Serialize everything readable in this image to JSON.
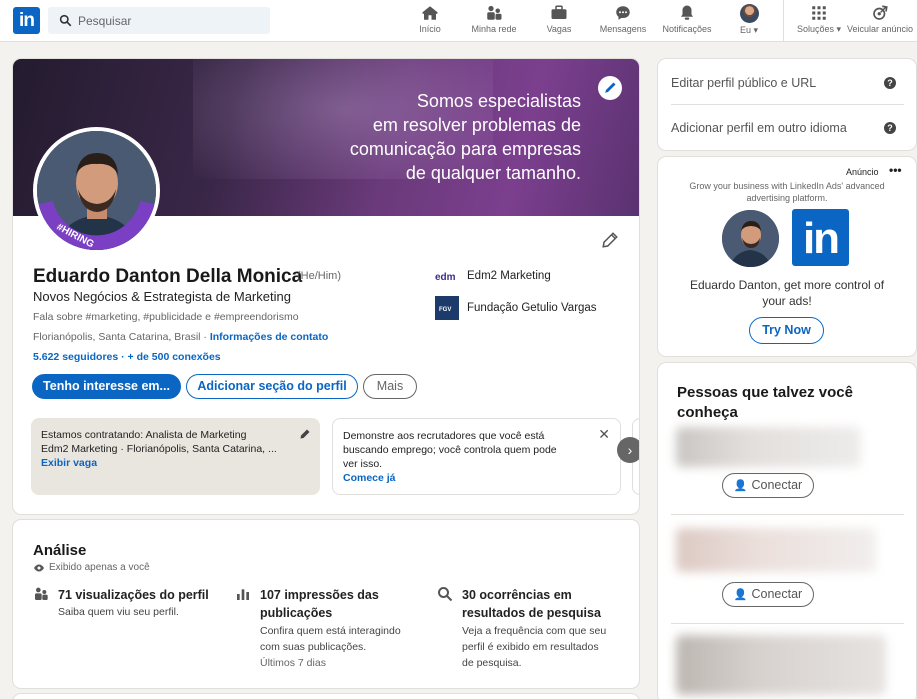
{
  "nav": {
    "search_placeholder": "Pesquisar",
    "items": [
      {
        "label": "Início",
        "icon": "home-icon"
      },
      {
        "label": "Minha rede",
        "icon": "network-icon"
      },
      {
        "label": "Vagas",
        "icon": "briefcase-icon"
      },
      {
        "label": "Mensagens",
        "icon": "messaging-icon"
      },
      {
        "label": "Notificações",
        "icon": "bell-icon"
      },
      {
        "label": "Eu ▾",
        "icon": "avatar"
      },
      {
        "label": "Soluções ▾",
        "icon": "grid-icon"
      },
      {
        "label": "Veicular anúncio",
        "icon": "ad-compass-icon"
      }
    ]
  },
  "profile": {
    "banner_lines": [
      "Somos especialistas",
      "em resolver problemas de",
      "comunicação para empresas",
      "de qualquer tamanho."
    ],
    "hiring_badge": "#HIRING",
    "name": "Eduardo Danton Della Monica",
    "pronouns": "(He/Him)",
    "headline": "Novos Negócios & Estrategista de Marketing",
    "about": "Fala sobre #marketing, #publicidade e #empreendorismo",
    "location": "Florianópolis, Santa Catarina, Brasil · ",
    "contact_link": "Informações de contato",
    "followers": "5.622 seguidores",
    "connections": " · + de 500 conexões",
    "experiences": [
      {
        "name": "Edm2 Marketing",
        "logo_text": "edm"
      },
      {
        "name": "Fundação Getulio Vargas",
        "logo_text": "FGV"
      }
    ],
    "buttons": {
      "primary": "Tenho interesse em...",
      "add_section": "Adicionar seção do perfil",
      "more": "Mais"
    },
    "hiring_box": {
      "line1": "Estamos contratando: Analista de Marketing",
      "line2": "Edm2 Marketing · Florianópolis, Santa Catarina, ...",
      "link": "Exibir vaga"
    },
    "open_box": {
      "line1": "Demonstre aos recrutadores que você está",
      "line2": "buscando emprego; você controla quem pode",
      "line3": "ver isso.",
      "link": "Comece já"
    }
  },
  "analytics": {
    "title": "Análise",
    "subtitle": "Exibido apenas a você",
    "items": [
      {
        "title": "71 visualizações do perfil",
        "desc": [
          "Saiba quem viu seu perfil."
        ]
      },
      {
        "title_lines": [
          "107 impressões das",
          "publicações"
        ],
        "desc": [
          "Confira quem está interagindo",
          "com suas publicações."
        ],
        "extra": "Últimos 7 dias"
      },
      {
        "title_lines": [
          "30 ocorrências em",
          "resultados de pesquisa"
        ],
        "desc": [
          "Veja a frequência com que seu",
          "perfil é exibido em resultados",
          "de pesquisa."
        ]
      }
    ]
  },
  "rail": {
    "edit_url": "Editar perfil público e URL",
    "add_language": "Adicionar perfil em outro idioma",
    "help_glyph": "?",
    "ad": {
      "label": "Anúncio",
      "dots": "•••",
      "tagline": "Grow your business with LinkedIn Ads' advanced advertising platform.",
      "li_text": "in",
      "message": "Eduardo Danton, get more control of your ads!",
      "cta": "Try Now"
    },
    "pymk": {
      "title": "Pessoas que talvez você conheça",
      "connect_label": "Conectar"
    }
  },
  "colors": {
    "brand": "#0a66c2",
    "background": "#f3f2ef",
    "hiring": "#7b3fc4"
  }
}
